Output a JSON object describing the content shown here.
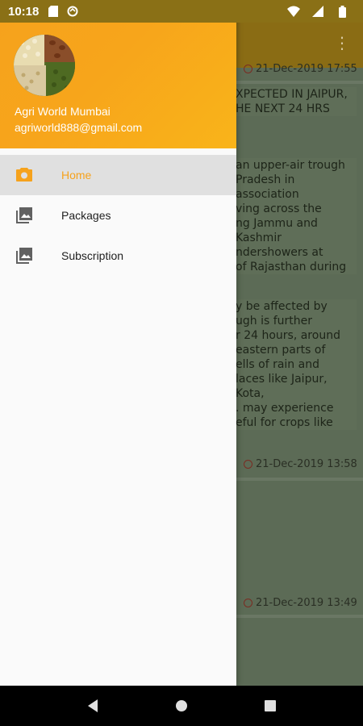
{
  "status_bar": {
    "time": "10:18",
    "icons": [
      "sd-card-icon",
      "sync-icon",
      "wifi-icon",
      "signal-icon",
      "battery-icon"
    ]
  },
  "drawer": {
    "header": {
      "name": "Agri World Mumbai",
      "email": "agriworld888@gmail.com",
      "avatar_icon": "grains-avatar"
    },
    "items": [
      {
        "label": "Home",
        "icon": "camera-icon",
        "active": true
      },
      {
        "label": "Packages",
        "icon": "gallery-icon",
        "active": false
      },
      {
        "label": "Subscription",
        "icon": "gallery-icon",
        "active": false
      }
    ]
  },
  "background": {
    "card1": {
      "timestamp": "21-Dec-2019 17:55",
      "title": "XPECTED IN JAIPUR,\nHE NEXT 24 HRS",
      "body1": "an upper-air trough\nPradesh in association\nving across the\nng Jammu and Kashmir\nndershowers at\nof Rajasthan during",
      "body2": "y be affected by\nugh is further\nr 24 hours, around\neastern parts of\nells of rain and\nlaces like Jaipur, Kota,\n. may experience\neful for crops like",
      "footer_timestamp": "21-Dec-2019 13:58"
    },
    "card2": {
      "timestamp": "21-Dec-2019 13:49"
    }
  },
  "colors": {
    "accent": "#f6a21c",
    "toolbar": "#8a6c14",
    "status_bar": "#8a7016"
  }
}
